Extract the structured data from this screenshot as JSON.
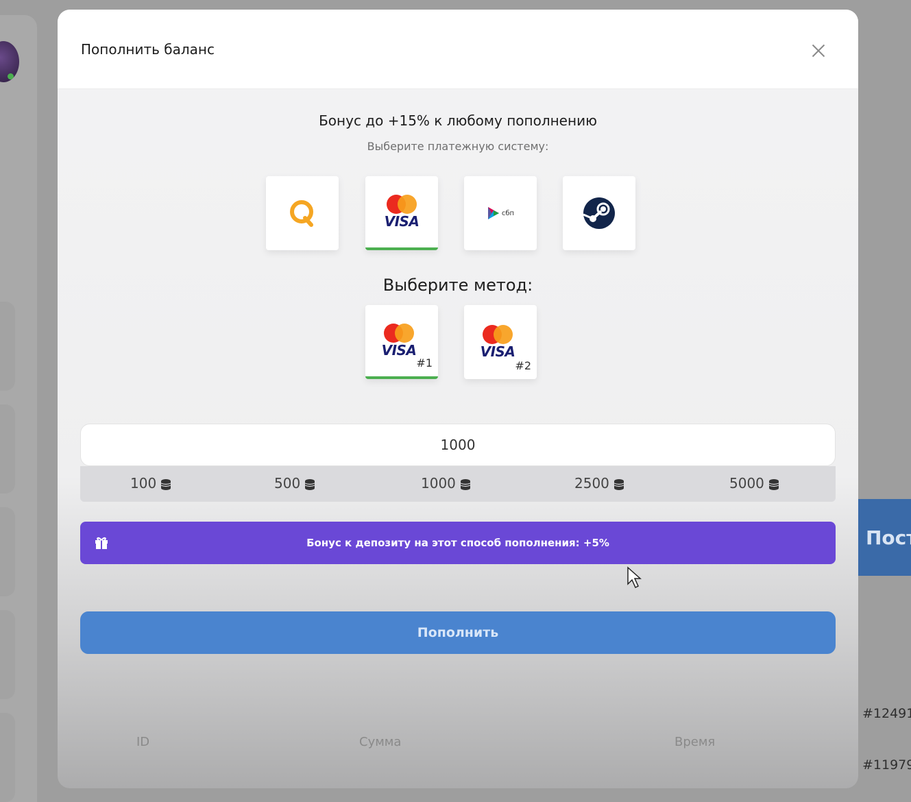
{
  "background": {
    "right_panel_label": "Пост",
    "transaction_ids": [
      "#12491",
      "#11979"
    ]
  },
  "modal": {
    "title": "Пополнить баланс",
    "bonus_heading": "Бонус до +15% к любому пополнению",
    "choose_system_label": "Выберите платежную систему:",
    "payment_systems": [
      {
        "name": "qiwi",
        "icon": "qiwi-icon"
      },
      {
        "name": "card",
        "icon": "mastercard-visa-icon",
        "label": "VISA",
        "selected": true
      },
      {
        "name": "sbp",
        "icon": "sbp-icon",
        "label": "сбп"
      },
      {
        "name": "steam",
        "icon": "steam-icon"
      }
    ],
    "choose_method_label": "Выберите метод:",
    "methods": [
      {
        "label": "VISA",
        "number": "#1",
        "selected": true
      },
      {
        "label": "VISA",
        "number": "#2",
        "selected": false
      }
    ],
    "amount_value": "1000",
    "presets": [
      "100",
      "500",
      "1000",
      "2500",
      "5000"
    ],
    "bonus_bar_text": "Бонус к депозиту на этот способ пополнения: +5%",
    "submit_label": "Пополнить",
    "table_headers": [
      "ID",
      "Сумма",
      "Время"
    ]
  },
  "colors": {
    "accent_blue": "#4a84cf",
    "bonus_purple": "#6a48d6",
    "selected_green": "#4caf50"
  }
}
